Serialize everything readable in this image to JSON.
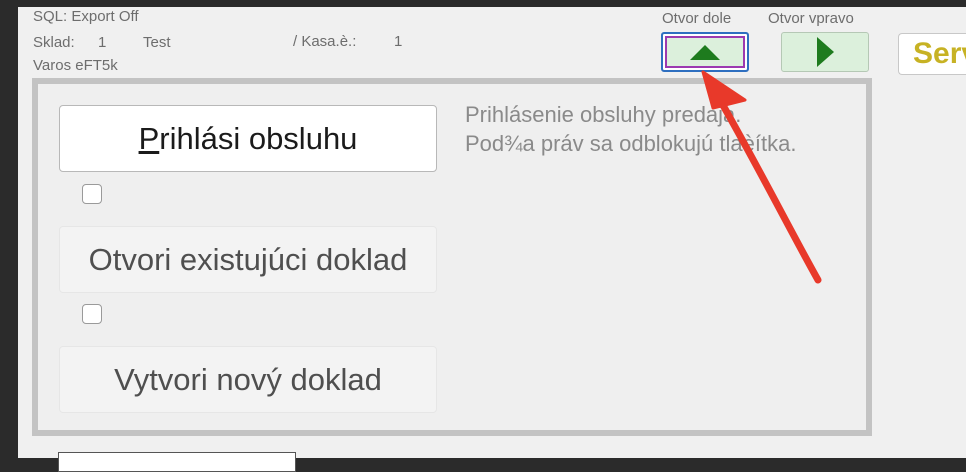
{
  "header": {
    "sql_status": "SQL: Export Off",
    "sklad_label": "Sklad:",
    "sklad_number": "1",
    "sklad_name": "Test",
    "kasa_label": "/ Kasa.è.:",
    "kasa_number": "1",
    "location": "Varos eFT5k"
  },
  "door": {
    "down_label": "Otvor dole",
    "right_label": "Otvor vpravo",
    "down_icon": "triangle-up-icon",
    "right_icon": "triangle-right-icon",
    "icon_color": "#1e7b1e"
  },
  "serv_button": {
    "label": "Servis",
    "color": "#c7b224"
  },
  "main": {
    "login": {
      "mnemonic": "P",
      "rest": "rihlási obsluhu"
    },
    "open_doc_label": "Otvori existujúci doklad",
    "new_doc_label": "Vytvori nový doklad",
    "checkbox_1": false,
    "checkbox_2": false,
    "hint_line_1": "Prihlásenie obsluhy predaja.",
    "hint_line_2": "Pod¾a práv sa odblokujú tlaèítka."
  },
  "annotation": {
    "color": "#e8392a",
    "icon": "red-arrow-annotation"
  }
}
